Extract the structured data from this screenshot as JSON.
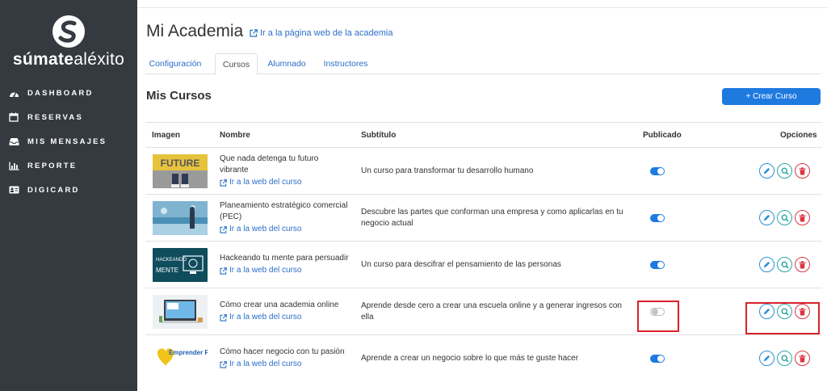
{
  "brand": {
    "name_bold": "súmate",
    "name_light": "aléxito"
  },
  "sidebar": {
    "items": [
      {
        "label": "DASHBOARD",
        "icon": "dashboard-icon"
      },
      {
        "label": "RESERVAS",
        "icon": "calendar-icon"
      },
      {
        "label": "MIS MENSAJES",
        "icon": "inbox-icon"
      },
      {
        "label": "REPORTE",
        "icon": "bar-chart-icon"
      },
      {
        "label": "DIGICARD",
        "icon": "id-card-icon"
      }
    ]
  },
  "header": {
    "title": "Mi Academia",
    "web_link": "Ir a la página web de la academia"
  },
  "tabs": [
    {
      "label": "Configuración",
      "active": false
    },
    {
      "label": "Cursos",
      "active": true
    },
    {
      "label": "Alumnado",
      "active": false
    },
    {
      "label": "Instructores",
      "active": false
    }
  ],
  "courses_section": {
    "title": "Mis Cursos",
    "create_button": "+ Crear Curso"
  },
  "table": {
    "headers": {
      "image": "Imagen",
      "name": "Nombre",
      "subtitle": "Subtítulo",
      "published": "Publicado",
      "options": "Opciones"
    },
    "rows": [
      {
        "name": "Que nada detenga tu futuro vibrante",
        "link": "Ir a la web del curso",
        "subtitle": "Un curso para transformar tu desarrollo humano",
        "published": true,
        "thumb_text": "FUTURE"
      },
      {
        "name": "Planeamiento estratégico comercial (PEC)",
        "link": "Ir a la web del curso",
        "subtitle": "Descubre las partes que conforman una empresa y como aplicarlas en tu negocio actual",
        "published": true,
        "thumb_text": ""
      },
      {
        "name": "Hackeando tu mente para persuadir",
        "link": "Ir a la web del curso",
        "subtitle": "Un curso para descifrar el pensamiento de las personas",
        "published": true,
        "thumb_text": "HACKEANDO MENTE"
      },
      {
        "name": "Cómo crear una academia online",
        "link": "Ir a la web del curso",
        "subtitle": "Aprende desde cero a crear una escuela online y a generar ingresos con ella",
        "published": false,
        "thumb_text": ""
      },
      {
        "name": "Cómo hacer negocio con tu pasión",
        "link": "Ir a la web del curso",
        "subtitle": "Aprende a crear un negocio sobre lo que más te guste hacer",
        "published": true,
        "thumb_text": "Emprender Pasión"
      }
    ]
  },
  "colors": {
    "sidebar_bg": "#343a40",
    "primary": "#1f7ae0",
    "link": "#2a6fc9",
    "danger": "#dc3545",
    "highlight": "#d8222a"
  }
}
